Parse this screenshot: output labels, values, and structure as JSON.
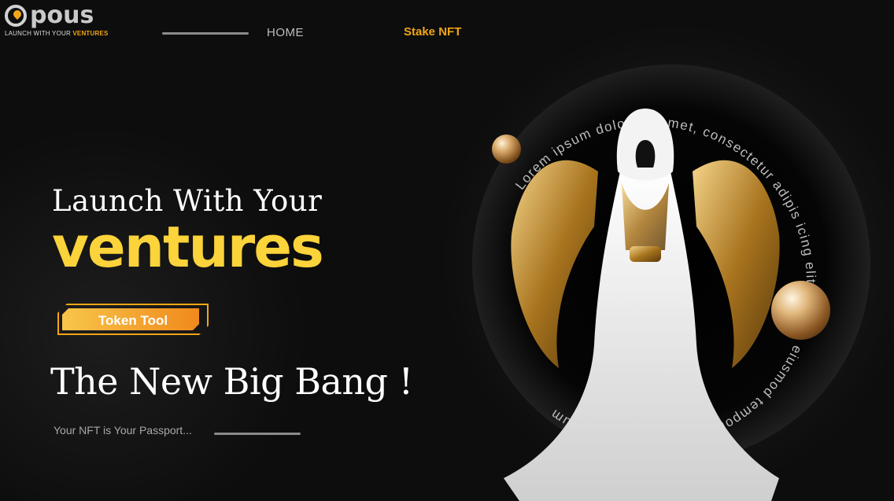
{
  "brand": {
    "logo_text": "pous",
    "tagline_prefix": "LAUNCH WITH YOUR ",
    "tagline_accent": "VENTURES",
    "accent_color": "#f2a516"
  },
  "nav": {
    "home_label": "HOME",
    "stake_label": "Stake NFT"
  },
  "hero": {
    "line1": "Launch With Your",
    "line2": "ventures",
    "button_label": "Token Tool",
    "headline": "The New Big Bang !",
    "subtext": "Your NFT is Your Passport..."
  },
  "visual": {
    "circular_text": "Lorem ipsum dolor sit amet, consectetur adipis icing elit, sed do eiusmod tempor incididunt. Lorem ipsum",
    "icons": [
      "angel-figure-illustration",
      "gold-sphere-icon"
    ]
  },
  "colors": {
    "background": "#0b0b0b",
    "title_yellow": "#fbd33a",
    "button_start": "#f8c54a",
    "button_end": "#f08a1c"
  }
}
